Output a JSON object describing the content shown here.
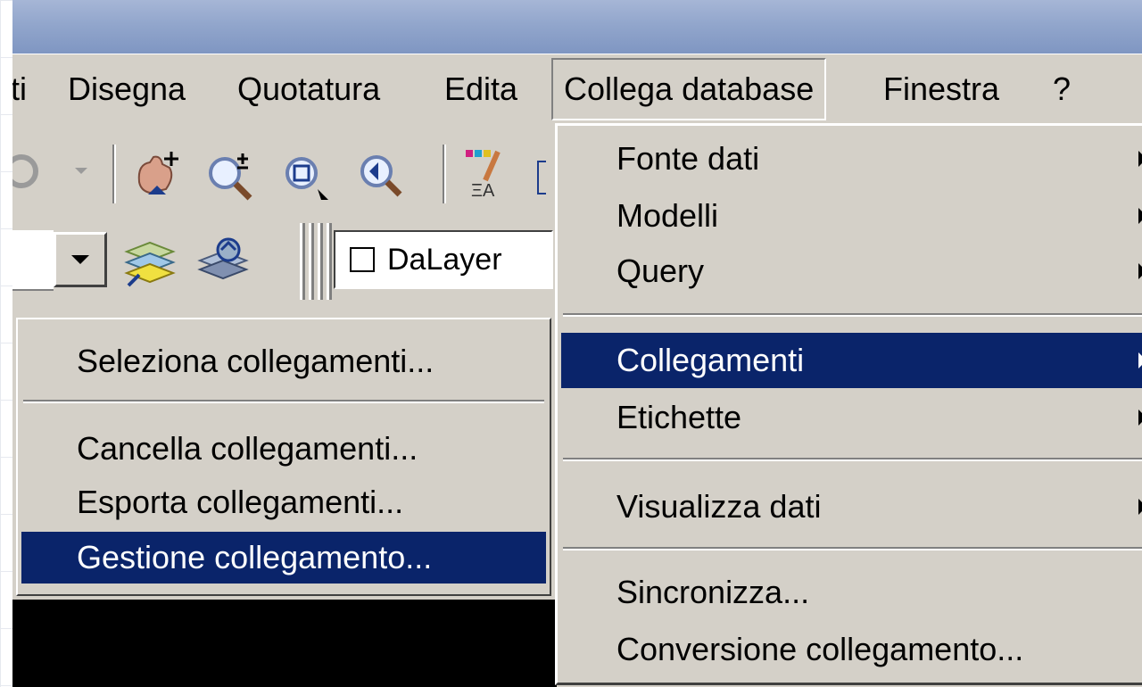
{
  "menubar": {
    "items": [
      {
        "label": "ti"
      },
      {
        "label": "Disegna"
      },
      {
        "label": "Quotatura"
      },
      {
        "label": "Edita"
      },
      {
        "label": "Collega database",
        "open": true
      },
      {
        "label": "Finestra"
      },
      {
        "label": "?"
      }
    ]
  },
  "toolbar": {
    "layer_value": "DaLayer",
    "icons": [
      "pan-icon",
      "zoom-realtime-icon",
      "zoom-window-icon",
      "zoom-previous-icon",
      "properties-match-icon",
      "layer-previous-icon",
      "layer-state-icon"
    ]
  },
  "collegamenti_submenu": {
    "items": [
      {
        "label": "Seleziona collegamenti..."
      },
      {
        "label": "Cancella collegamenti..."
      },
      {
        "label": "Esporta collegamenti..."
      },
      {
        "label": "Gestione collegamento...",
        "highlighted": true
      }
    ]
  },
  "database_menu": {
    "items": [
      {
        "label": "Fonte dati",
        "submenu": true
      },
      {
        "label": "Modelli",
        "submenu": true
      },
      {
        "label": "Query",
        "submenu": true
      },
      {
        "label": "Collegamenti",
        "submenu": true,
        "highlighted": true
      },
      {
        "label": "Etichette",
        "submenu": true
      },
      {
        "label": "Visualizza dati",
        "submenu": true
      },
      {
        "label": "Sincronizza..."
      },
      {
        "label": "Conversione collegamento..."
      }
    ]
  },
  "colors": {
    "menu_bg": "#d4d0c8",
    "highlight": "#0a246a",
    "titlebar": "#92a6cc"
  }
}
